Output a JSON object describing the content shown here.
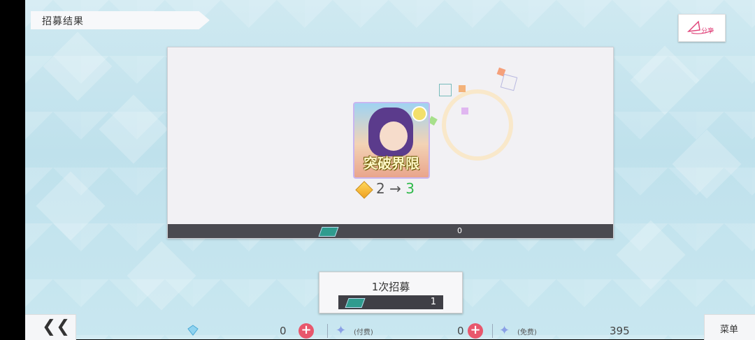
{
  "header": {
    "title": "招募结果",
    "share_label": "分享"
  },
  "result": {
    "card_title": "突破界限",
    "level_from": "2",
    "arrow": "→",
    "level_to": "3",
    "ticket_count": "0"
  },
  "pull_button": {
    "label": "1次招募",
    "cost": "1"
  },
  "footer": {
    "back_label": "❮❮",
    "menu_label": "菜单",
    "gems_value": "0",
    "paid_label": "(付费)",
    "paid_value": "0",
    "free_label": "(免费)",
    "free_value": "395"
  },
  "colors": {
    "accent_plus": "#e8576c",
    "upgrade_green": "#2fb94a",
    "ticket_teal": "#2f9b8e"
  },
  "icons": [
    "back-double-chevron-icon",
    "share-icon",
    "ticket-icon",
    "diamond-gem-icon",
    "plus-icon",
    "star-crystal-icon",
    "orange-gem-icon",
    "star-badge-icon"
  ]
}
